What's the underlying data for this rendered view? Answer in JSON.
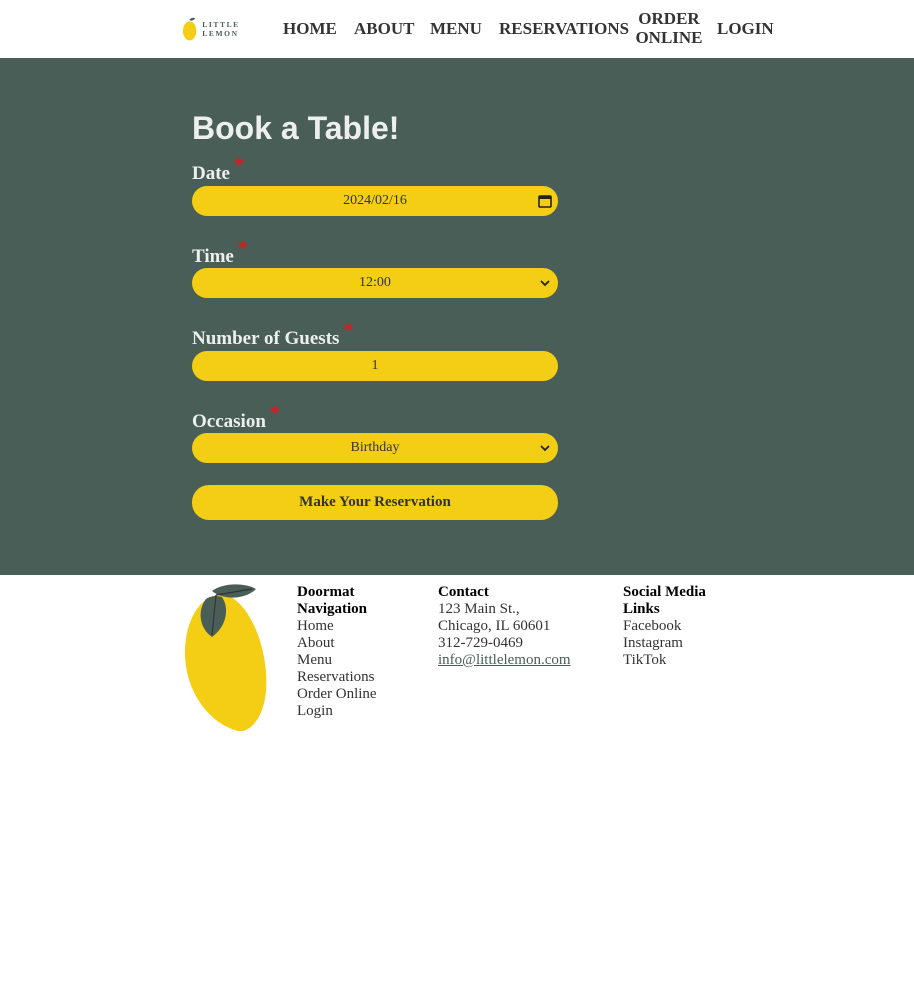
{
  "header": {
    "logo_text": "LITTLE LEMON",
    "nav": {
      "home": "HOME",
      "about": "ABOUT",
      "menu": "MENU",
      "reservations": "RESERVATIONS",
      "order_online_line1": "ORDER",
      "order_online_line2": "ONLINE",
      "login": "LOGIN"
    }
  },
  "form": {
    "title": "Book a Table!",
    "required_mark": "*",
    "date": {
      "label": "Date",
      "value": "2024/02/16"
    },
    "time": {
      "label": "Time",
      "value": "12:00"
    },
    "guests": {
      "label": "Number of Guests",
      "value": "1"
    },
    "occasion": {
      "label": "Occasion",
      "value": "Birthday"
    },
    "submit_label": "Make Your Reservation"
  },
  "footer": {
    "nav": {
      "heading_line1": "Doormat",
      "heading_line2": "Navigation",
      "links": [
        "Home",
        "About",
        "Menu",
        "Reservations",
        "Order Online",
        "Login"
      ]
    },
    "contact": {
      "heading": "Contact",
      "address_line1": "123 Main St.,",
      "address_line2": "Chicago, IL 60601",
      "phone": "312-729-0469",
      "email": "info@littlelemon.com"
    },
    "social": {
      "heading_line1": "Social Media",
      "heading_line2": "Links",
      "links": [
        "Facebook",
        "Instagram",
        "TikTok"
      ]
    }
  },
  "colors": {
    "primary_green": "#495e57",
    "primary_yellow": "#f4ce14",
    "required_red": "#e0181d",
    "light_text": "#edefee"
  }
}
